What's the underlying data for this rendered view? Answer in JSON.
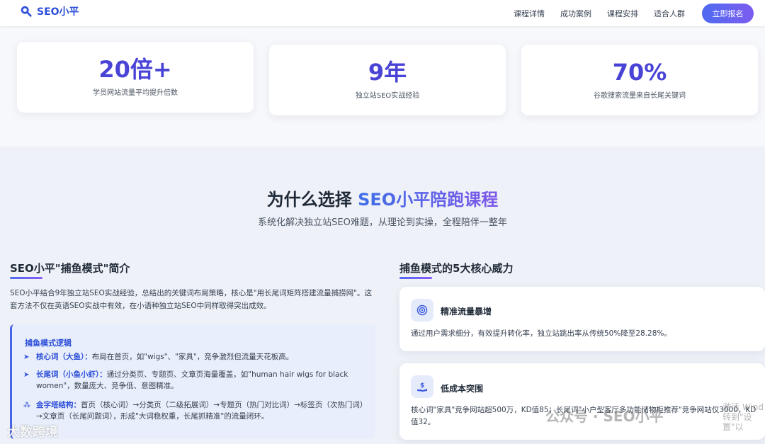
{
  "header": {
    "logo_text": "SEO小平",
    "nav": [
      "课程详情",
      "成功案例",
      "课程安排",
      "适合人群"
    ],
    "cta_label": "立即报名"
  },
  "stats": [
    {
      "value": "20倍+",
      "label": "学员网站流量平均提升倍数"
    },
    {
      "value": "9年",
      "label": "独立站SEO实战经验"
    },
    {
      "value": "70%",
      "label": "谷歌搜索流量来自长尾关键词"
    }
  ],
  "why": {
    "title_prefix": "为什么选择 ",
    "title_highlight": "SEO小平陪跑课程",
    "subtitle": "系统化解决独立站SEO难题，从理论到实操，全程陪伴一整年"
  },
  "left": {
    "title": "SEO小平\"捕鱼模式\"简介",
    "intro": "SEO小平结合9年独立站SEO实战经验，总结出的关键词布局策略，核心是\"用长尾词矩阵搭建流量捕捞网\"。这套方法不仅在英语SEO实战中有效，在小语种独立站SEO中同样取得突出成效。",
    "logic_title": "捕鱼模式逻辑",
    "items": [
      {
        "key": "核心词（大鱼）：",
        "text": "布局在首页，如\"wigs\"、\"家具\"，竞争激烈但流量天花板高。"
      },
      {
        "key": "长尾词（小鱼小虾）：",
        "text": "通过分类页、专题页、文章页海量覆盖，如\"human hair wigs for black women\"，数量庞大、竞争低、意图精准。"
      },
      {
        "key": "金字塔结构：",
        "text": "首页（核心词）→分类页（二级拓展词）→专题页（热门对比词）→标签页（次热门词）→文章页（长尾问题词），形成\"大词稳权重，长尾抓精准\"的流量闭环。"
      }
    ]
  },
  "right": {
    "title": "捕鱼模式的5大核心威力",
    "cards": [
      {
        "name": "精准流量暴增",
        "desc": "通过用户需求细分，有效提升转化率，独立站跳出率从传统50%降至28.28%。"
      },
      {
        "name": "低成本突围",
        "desc": "核心词\"家具\"竞争网站超500万，KD值85；长尾词\"小户型客厅多功能储物柜推荐\"竞争网站仅3000，KD值32。"
      }
    ]
  },
  "watermarks": {
    "left": "大数跨境",
    "right": "公众号 · SEO小平",
    "corner_line1": "激活 Wind",
    "corner_line2": "转到\"设置\"以"
  },
  "colors": {
    "brand": "#2d4fd8",
    "accent_start": "#4f6bf0",
    "accent_end": "#8b5cf6"
  }
}
